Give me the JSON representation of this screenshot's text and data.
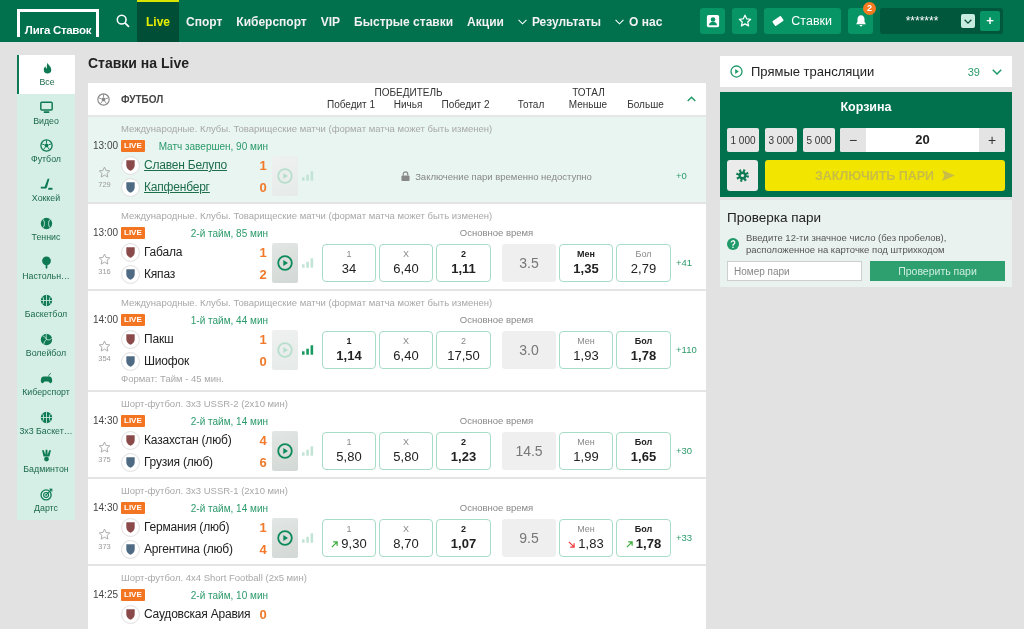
{
  "header": {
    "logo": "Лига Ставок",
    "nav": [
      {
        "label": "Live",
        "selected": true,
        "dropdown": false
      },
      {
        "label": "Спорт",
        "selected": false,
        "dropdown": false
      },
      {
        "label": "Киберспорт",
        "selected": false,
        "dropdown": false
      },
      {
        "label": "VIP",
        "selected": false,
        "dropdown": false
      },
      {
        "label": "Быстрые ставки",
        "selected": false,
        "dropdown": false
      },
      {
        "label": "Акции",
        "selected": false,
        "dropdown": false
      },
      {
        "label": "Результаты",
        "selected": false,
        "dropdown": true
      },
      {
        "label": "О нас",
        "selected": false,
        "dropdown": true
      }
    ],
    "bets_button": "Ставки",
    "notification_count": "2",
    "balance": "*******",
    "deposit_button": "+"
  },
  "sidebar": {
    "items": [
      {
        "label": "Все",
        "kind": "all",
        "selected": true
      },
      {
        "label": "Видео",
        "kind": "video",
        "selected": false
      },
      {
        "label": "Футбол",
        "kind": "football",
        "selected": false
      },
      {
        "label": "Хоккей",
        "kind": "hockey",
        "selected": false
      },
      {
        "label": "Теннис",
        "kind": "tennis",
        "selected": false
      },
      {
        "label": "Настольн…",
        "kind": "table-tennis",
        "selected": false
      },
      {
        "label": "Баскетбол",
        "kind": "basketball",
        "selected": false
      },
      {
        "label": "Волейбол",
        "kind": "volleyball",
        "selected": false
      },
      {
        "label": "Киберспорт",
        "kind": "esports",
        "selected": false
      },
      {
        "label": "3х3 Баскет…",
        "kind": "basketball",
        "selected": false
      },
      {
        "label": "Бадминтон",
        "kind": "badminton",
        "selected": false
      },
      {
        "label": "Дартс",
        "kind": "darts",
        "selected": false
      }
    ]
  },
  "main": {
    "title": "Ставки на Live",
    "sport": "ФУТБОЛ",
    "expanded": true,
    "column_groups": [
      "ПОБЕДИТЕЛЬ",
      "ТОТАЛ"
    ],
    "columns": [
      "Победит 1",
      "Ничья",
      "Победит 2",
      "Тотал",
      "Меньше",
      "Больше"
    ],
    "matches": [
      {
        "kind": "locked",
        "tournament": "Международные. Клубы. Товарищеские матчи (формат матча может быть изменен)",
        "time": "13:00",
        "live_badge": "LIVE",
        "status": "Матч завершен, 90 мин",
        "finished": true,
        "favorite_count": "729",
        "video_available": false,
        "stats_active": false,
        "teams": [
          {
            "name": "Славен Белупо",
            "score": "1"
          },
          {
            "name": "Капфенберг",
            "score": "0"
          }
        ],
        "locked_message": "Заключение пари временно недоступно",
        "more": "+0"
      },
      {
        "kind": "odds",
        "tournament": "Международные. Клубы. Товарищеские матчи (формат матча может быть изменен)",
        "time": "13:00",
        "live_badge": "LIVE",
        "status": "2-й тайм, 85 мин",
        "finished": false,
        "favorite_count": "316",
        "video_available": true,
        "stats_active": false,
        "teams": [
          {
            "name": "Габала",
            "score": "1"
          },
          {
            "name": "Кяпаз",
            "score": "2"
          }
        ],
        "market": "Основное время",
        "win_odds": [
          {
            "label": "1",
            "value": "34",
            "favorite": false,
            "rising": false,
            "falling": false
          },
          {
            "label": "X",
            "value": "6,40",
            "favorite": false,
            "rising": false,
            "falling": false
          },
          {
            "label": "2",
            "value": "1,11",
            "favorite": true,
            "rising": false,
            "falling": false
          }
        ],
        "total": "3.5",
        "total_odds": [
          {
            "label": "Мен",
            "value": "1,35",
            "favorite": true,
            "rising": false,
            "falling": false
          },
          {
            "label": "Бол",
            "value": "2,79",
            "favorite": false,
            "rising": false,
            "falling": false
          }
        ],
        "more": "+41"
      },
      {
        "kind": "odds",
        "tournament": "Международные. Клубы. Товарищеские матчи (формат матча может быть изменен)",
        "time": "14:00",
        "live_badge": "LIVE",
        "status": "1-й тайм, 44 мин",
        "finished": false,
        "favorite_count": "354",
        "video_available": false,
        "stats_active": true,
        "teams": [
          {
            "name": "Пакш",
            "score": "1"
          },
          {
            "name": "Шиофок",
            "score": "0"
          }
        ],
        "note": "Формат: Тайм - 45 мин.",
        "market": "Основное время",
        "win_odds": [
          {
            "label": "1",
            "value": "1,14",
            "favorite": true,
            "rising": false,
            "falling": false
          },
          {
            "label": "X",
            "value": "6,40",
            "favorite": false,
            "rising": false,
            "falling": false
          },
          {
            "label": "2",
            "value": "17,50",
            "favorite": false,
            "rising": false,
            "falling": false
          }
        ],
        "total": "3.0",
        "total_odds": [
          {
            "label": "Мен",
            "value": "1,93",
            "favorite": false,
            "rising": false,
            "falling": false
          },
          {
            "label": "Бол",
            "value": "1,78",
            "favorite": true,
            "rising": false,
            "falling": false
          }
        ],
        "more": "+110"
      },
      {
        "kind": "odds",
        "tournament": "Шорт-футбол. 3х3 USSR-2 (2х10 мин)",
        "time": "14:30",
        "live_badge": "LIVE",
        "status": "2-й тайм, 14 мин",
        "finished": false,
        "favorite_count": "375",
        "video_available": true,
        "stats_active": false,
        "teams": [
          {
            "name": "Казахстан (люб)",
            "score": "4"
          },
          {
            "name": "Грузия (люб)",
            "score": "6"
          }
        ],
        "market": "Основное время",
        "win_odds": [
          {
            "label": "1",
            "value": "5,80",
            "favorite": false,
            "rising": false,
            "falling": false
          },
          {
            "label": "X",
            "value": "5,80",
            "favorite": false,
            "rising": false,
            "falling": false
          },
          {
            "label": "2",
            "value": "1,23",
            "favorite": true,
            "rising": false,
            "falling": false
          }
        ],
        "total": "14.5",
        "total_odds": [
          {
            "label": "Мен",
            "value": "1,99",
            "favorite": false,
            "rising": false,
            "falling": false
          },
          {
            "label": "Бол",
            "value": "1,65",
            "favorite": true,
            "rising": false,
            "falling": false
          }
        ],
        "more": "+30"
      },
      {
        "kind": "odds",
        "tournament": "Шорт-футбол. 3х3 USSR-1 (2х10 мин)",
        "time": "14:30",
        "live_badge": "LIVE",
        "status": "2-й тайм, 14 мин",
        "finished": false,
        "favorite_count": "373",
        "video_available": true,
        "stats_active": false,
        "teams": [
          {
            "name": "Германия (люб)",
            "score": "1"
          },
          {
            "name": "Аргентина (люб)",
            "score": "4"
          }
        ],
        "market": "Основное время",
        "win_odds": [
          {
            "label": "1",
            "value": "9,30",
            "favorite": false,
            "rising": true,
            "falling": false
          },
          {
            "label": "X",
            "value": "8,70",
            "favorite": false,
            "rising": false,
            "falling": false
          },
          {
            "label": "2",
            "value": "1,07",
            "favorite": true,
            "rising": false,
            "falling": false
          }
        ],
        "total": "9.5",
        "total_odds": [
          {
            "label": "Мен",
            "value": "1,83",
            "favorite": false,
            "rising": false,
            "falling": true
          },
          {
            "label": "Бол",
            "value": "1,78",
            "favorite": true,
            "rising": true,
            "falling": false
          }
        ],
        "more": "+33"
      },
      {
        "kind": "cut_off",
        "tournament": "Шорт-футбол. 4х4 Short Football (2х5 мин)",
        "time": "14:25",
        "live_badge": "LIVE",
        "status": "2-й тайм, 10 мин",
        "finished": false,
        "teams": [
          {
            "name": "Саудовская Аравия",
            "score": "0"
          }
        ]
      }
    ]
  },
  "live_streams": {
    "title": "Прямые трансляции",
    "count": "39",
    "expanded": false
  },
  "betslip": {
    "title": "Корзина",
    "quick_amounts": [
      "1 000",
      "3 000",
      "5 000"
    ],
    "decrease": "−",
    "amount": "20",
    "increase": "+",
    "place_bet": "ЗАКЛЮЧИТЬ ПАРИ",
    "place_bet_disabled": true
  },
  "bet_check": {
    "title": "Проверка пари",
    "hint": "Введите 12-ти значное число (без пробелов), расположенное на карточке под штрихкодом",
    "placeholder": "Номер пари",
    "button": "Проверить пари"
  }
}
